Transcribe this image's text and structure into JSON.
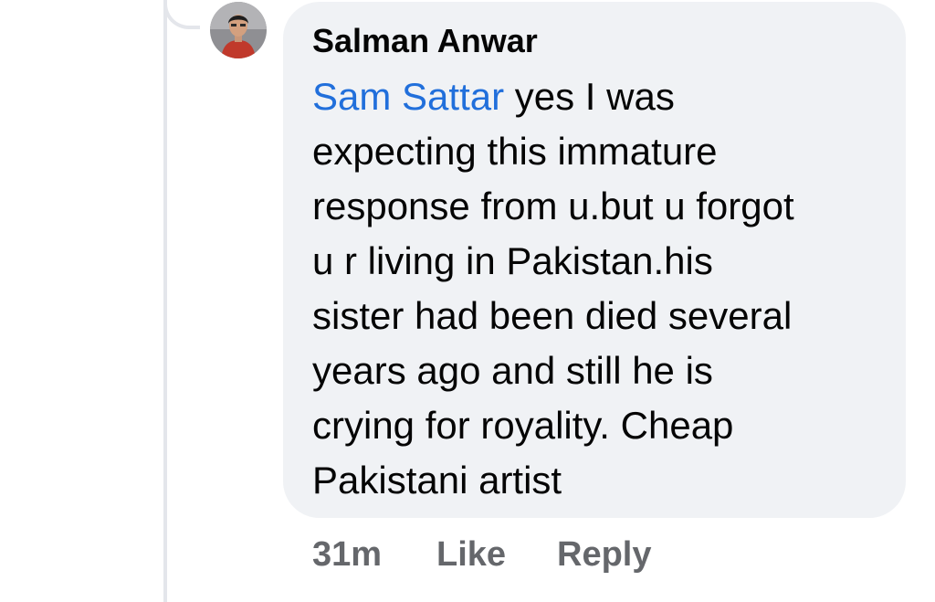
{
  "comment": {
    "author": "Salman Anwar",
    "mention": "Sam Sattar",
    "text_lines": [
      " yes I was",
      "expecting this immature",
      "response from u.but u forgot",
      "u r living in Pakistan.his",
      "sister had been died several",
      "years ago and still he is",
      "crying for royality. Cheap",
      "Pakistani artist"
    ],
    "avatar_icon": "user-avatar-photo",
    "mention_color": "#216fdb",
    "bubble_color": "#f0f2f5"
  },
  "actions": {
    "timestamp": "31m",
    "like_label": "Like",
    "reply_label": "Reply"
  }
}
